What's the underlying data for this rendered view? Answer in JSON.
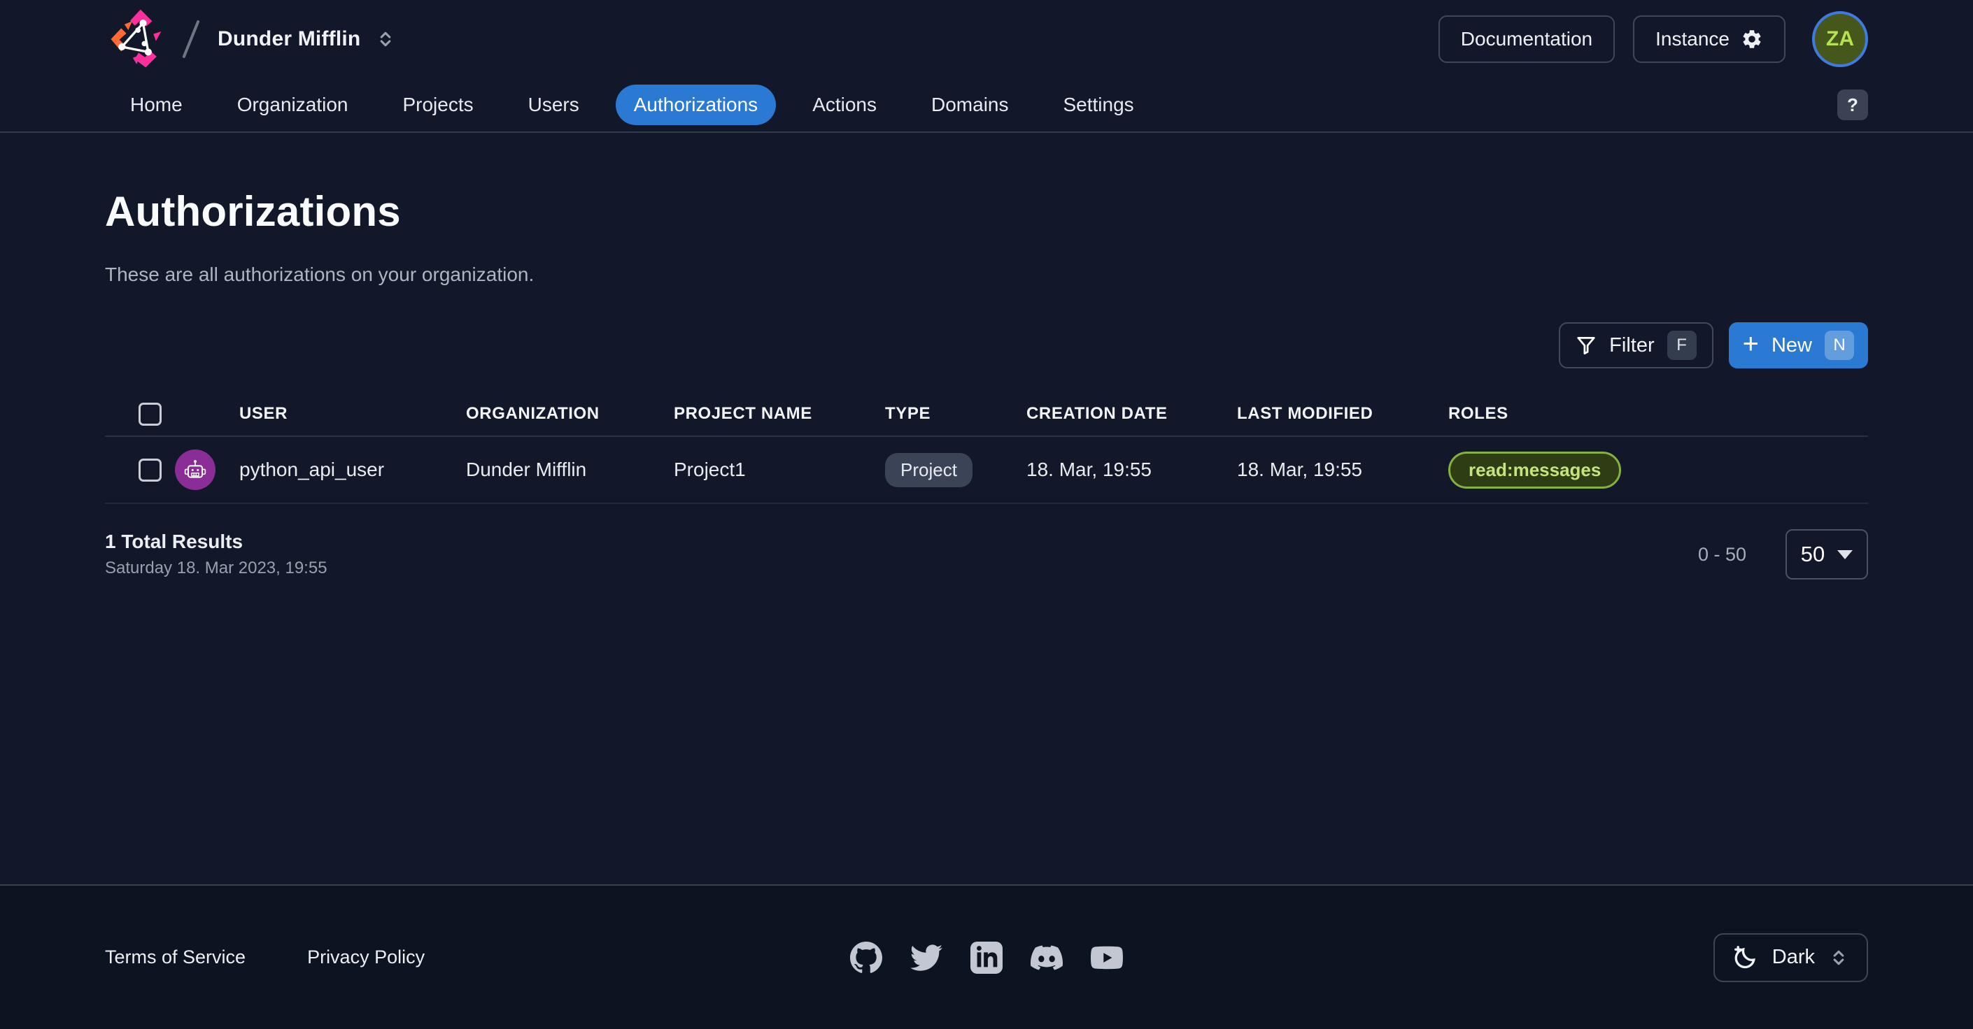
{
  "topbar": {
    "org_name": "Dunder Mifflin",
    "documentation_label": "Documentation",
    "instance_label": "Instance",
    "avatar_initials": "ZA"
  },
  "nav": {
    "tabs": [
      "Home",
      "Organization",
      "Projects",
      "Users",
      "Authorizations",
      "Actions",
      "Domains",
      "Settings"
    ],
    "active_tab": "Authorizations",
    "help_label": "?"
  },
  "page": {
    "title": "Authorizations",
    "subtitle": "These are all authorizations on your organization."
  },
  "toolbar": {
    "filter_label": "Filter",
    "filter_shortcut": "F",
    "plus_icon": "+",
    "new_label": "New",
    "new_shortcut": "N"
  },
  "table": {
    "headers": [
      "USER",
      "ORGANIZATION",
      "PROJECT NAME",
      "TYPE",
      "CREATION DATE",
      "LAST MODIFIED",
      "ROLES"
    ],
    "rows": [
      {
        "user": "python_api_user",
        "organization": "Dunder Mifflin",
        "project_name": "Project1",
        "type": "Project",
        "creation_date": "18. Mar, 19:55",
        "last_modified": "18. Mar, 19:55",
        "roles": [
          "read:messages"
        ]
      }
    ]
  },
  "summary": {
    "total": "1 Total Results",
    "timestamp": "Saturday 18. Mar 2023, 19:55",
    "range": "0 - 50",
    "page_size": "50"
  },
  "footer": {
    "links": [
      "Terms of Service",
      "Privacy Policy"
    ],
    "social": [
      "github",
      "twitter",
      "linkedin",
      "discord",
      "youtube"
    ],
    "theme_label": "Dark"
  },
  "colors": {
    "accent_blue": "#2a79d2",
    "background": "#121829",
    "footer_background": "#0d1421",
    "role_badge_text": "#c3e57c",
    "role_badge_border": "#85b23d",
    "user_avatar_purple": "#8b2d96",
    "profile_avatar_fill": "#46571b",
    "profile_avatar_text": "#b4e34f",
    "profile_avatar_ring": "#3d7be0",
    "type_badge_bg": "#3b4457"
  }
}
